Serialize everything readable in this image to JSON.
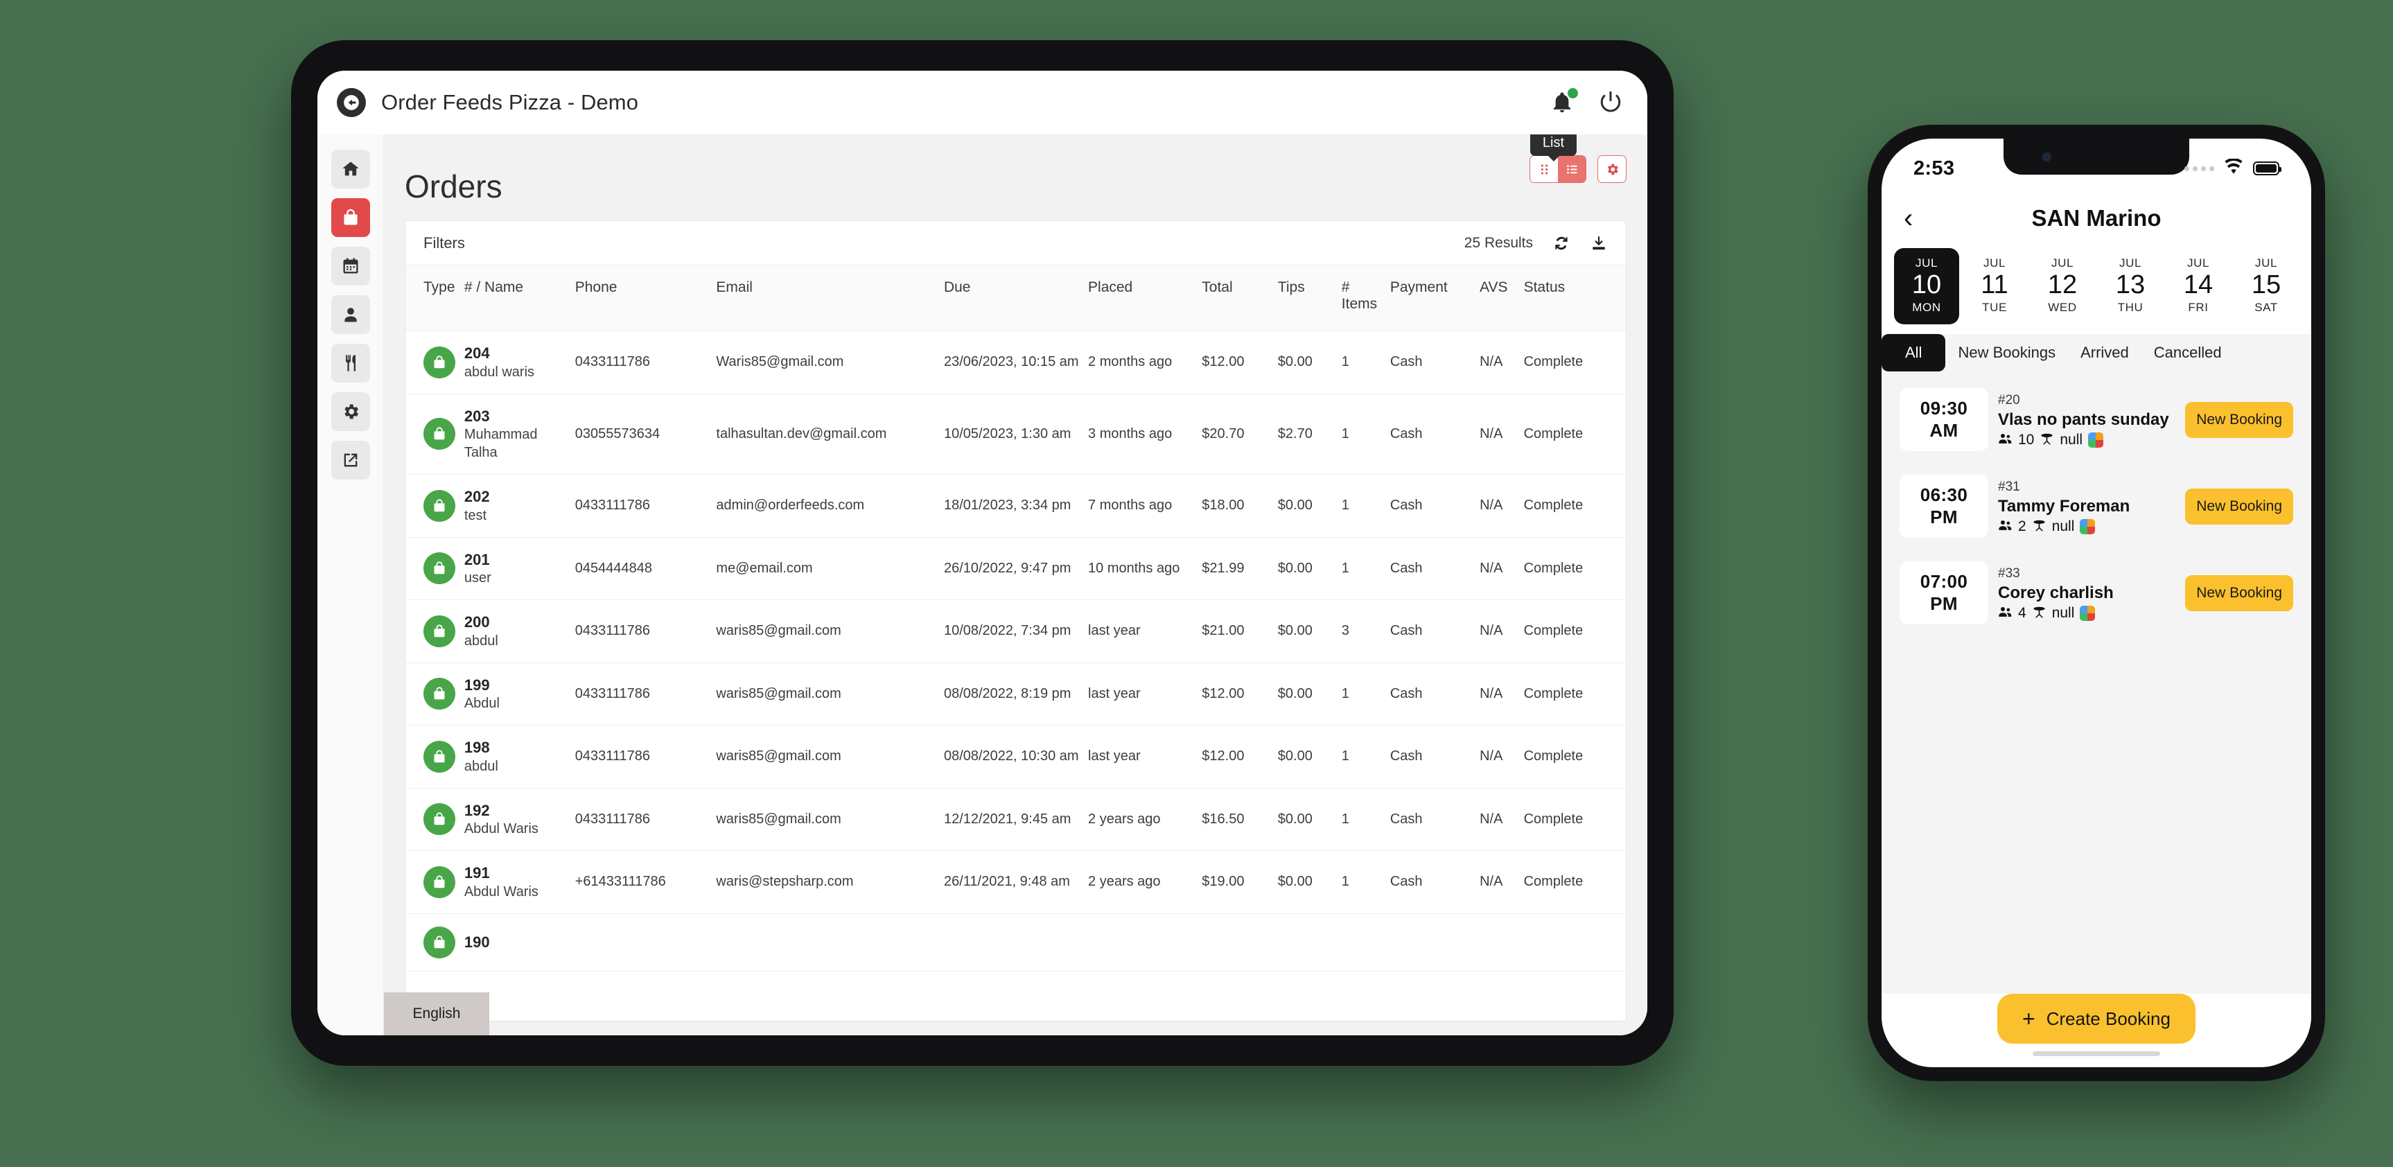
{
  "background_color": "#477150",
  "tablet": {
    "topbar": {
      "back_icon": "back-arrow-circle-icon",
      "title": "Order Feeds Pizza - Demo",
      "bell_icon": "notification-bell-icon",
      "bell_badge_color": "#2ea44f",
      "power_icon": "power-icon"
    },
    "sidebar": {
      "items": [
        {
          "icon": "home-icon",
          "name": "home",
          "active": false
        },
        {
          "icon": "shopping-bag-icon",
          "name": "orders",
          "active": true
        },
        {
          "icon": "calendar-icon",
          "name": "bookings",
          "active": false
        },
        {
          "icon": "person-icon",
          "name": "customers",
          "active": false
        },
        {
          "icon": "cutlery-icon",
          "name": "menu",
          "active": false
        },
        {
          "icon": "gear-icon",
          "name": "settings",
          "active": false
        },
        {
          "icon": "external-link-icon",
          "name": "open-external",
          "active": false
        }
      ],
      "active_color": "#e04a4a"
    },
    "page_title": "Orders",
    "view_toggle": {
      "tooltip": "List",
      "grid_icon": "grid-view-icon",
      "list_icon": "list-view-icon",
      "settings_icon": "gear-icon",
      "accent_color": "#e04a4a"
    },
    "panel": {
      "filters_label": "Filters",
      "results_count": "25 Results",
      "refresh_icon": "refresh-icon",
      "download_icon": "download-icon"
    },
    "table": {
      "columns": [
        "Type",
        "# / Name",
        "Phone",
        "Email",
        "Due",
        "Placed",
        "Total",
        "Tips",
        "# Items",
        "Payment",
        "AVS",
        "Status"
      ],
      "rows": [
        {
          "type_icon": "bag-icon",
          "number": "204",
          "name": "abdul waris",
          "phone": "0433111786",
          "email": "Waris85@gmail.com",
          "due": "23/06/2023, 10:15 am",
          "placed": "2 months ago",
          "total": "$12.00",
          "tips": "$0.00",
          "items": "1",
          "payment": "Cash",
          "avs": "N/A",
          "status": "Complete"
        },
        {
          "type_icon": "bag-icon",
          "number": "203",
          "name": "Muhammad Talha",
          "phone": "03055573634",
          "email": "talhasultan.dev@gmail.com",
          "due": "10/05/2023, 1:30 am",
          "placed": "3 months ago",
          "total": "$20.70",
          "tips": "$2.70",
          "items": "1",
          "payment": "Cash",
          "avs": "N/A",
          "status": "Complete"
        },
        {
          "type_icon": "bag-icon",
          "number": "202",
          "name": "test",
          "phone": "0433111786",
          "email": "admin@orderfeeds.com",
          "due": "18/01/2023, 3:34 pm",
          "placed": "7 months ago",
          "total": "$18.00",
          "tips": "$0.00",
          "items": "1",
          "payment": "Cash",
          "avs": "N/A",
          "status": "Complete"
        },
        {
          "type_icon": "bag-icon",
          "number": "201",
          "name": "user",
          "phone": "0454444848",
          "email": "me@email.com",
          "due": "26/10/2022, 9:47 pm",
          "placed": "10 months ago",
          "total": "$21.99",
          "tips": "$0.00",
          "items": "1",
          "payment": "Cash",
          "avs": "N/A",
          "status": "Complete"
        },
        {
          "type_icon": "bag-icon",
          "number": "200",
          "name": "abdul",
          "phone": "0433111786",
          "email": "waris85@gmail.com",
          "due": "10/08/2022, 7:34 pm",
          "placed": "last year",
          "total": "$21.00",
          "tips": "$0.00",
          "items": "3",
          "payment": "Cash",
          "avs": "N/A",
          "status": "Complete"
        },
        {
          "type_icon": "bag-icon",
          "number": "199",
          "name": "Abdul",
          "phone": "0433111786",
          "email": "waris85@gmail.com",
          "due": "08/08/2022, 8:19 pm",
          "placed": "last year",
          "total": "$12.00",
          "tips": "$0.00",
          "items": "1",
          "payment": "Cash",
          "avs": "N/A",
          "status": "Complete"
        },
        {
          "type_icon": "bag-icon",
          "number": "198",
          "name": "abdul",
          "phone": "0433111786",
          "email": "waris85@gmail.com",
          "due": "08/08/2022, 10:30 am",
          "placed": "last year",
          "total": "$12.00",
          "tips": "$0.00",
          "items": "1",
          "payment": "Cash",
          "avs": "N/A",
          "status": "Complete"
        },
        {
          "type_icon": "bag-icon",
          "number": "192",
          "name": "Abdul Waris",
          "phone": "0433111786",
          "email": "waris85@gmail.com",
          "due": "12/12/2021, 9:45 am",
          "placed": "2 years ago",
          "total": "$16.50",
          "tips": "$0.00",
          "items": "1",
          "payment": "Cash",
          "avs": "N/A",
          "status": "Complete"
        },
        {
          "type_icon": "bag-icon",
          "number": "191",
          "name": "Abdul Waris",
          "phone": "+61433111786",
          "email": "waris@stepsharp.com",
          "due": "26/11/2021, 9:48 am",
          "placed": "2 years ago",
          "total": "$19.00",
          "tips": "$0.00",
          "items": "1",
          "payment": "Cash",
          "avs": "N/A",
          "status": "Complete"
        },
        {
          "type_icon": "bag-icon",
          "number": "190",
          "name": "",
          "phone": "",
          "email": "",
          "due": "",
          "placed": "",
          "total": "",
          "tips": "",
          "items": "",
          "payment": "",
          "avs": "",
          "status": ""
        }
      ]
    },
    "language_tooltip": "English"
  },
  "phone": {
    "statusbar": {
      "time": "2:53",
      "wifi_icon": "wifi-icon",
      "battery_icon": "battery-icon"
    },
    "header": {
      "back_icon": "chevron-left-icon",
      "title": "SAN Marino"
    },
    "days": [
      {
        "month": "JUL",
        "day": "10",
        "dow": "MON",
        "active": true
      },
      {
        "month": "JUL",
        "day": "11",
        "dow": "TUE",
        "active": false
      },
      {
        "month": "JUL",
        "day": "12",
        "dow": "WED",
        "active": false
      },
      {
        "month": "JUL",
        "day": "13",
        "dow": "THU",
        "active": false
      },
      {
        "month": "JUL",
        "day": "14",
        "dow": "FRI",
        "active": false
      },
      {
        "month": "JUL",
        "day": "15",
        "dow": "SAT",
        "active": false
      }
    ],
    "tabs": [
      {
        "label": "All",
        "active": true
      },
      {
        "label": "New Bookings",
        "active": false
      },
      {
        "label": "Arrived",
        "active": false
      },
      {
        "label": "Cancelled",
        "active": false
      }
    ],
    "bookings": [
      {
        "time": "09:30",
        "ampm": "AM",
        "number": "#20",
        "name": "Vlas no pants sunday",
        "guests_icon": "people-icon",
        "guests": "10",
        "table_icon": "table-icon",
        "table": "null",
        "app_icon": "app-grid-icon",
        "status_label": "New Booking"
      },
      {
        "time": "06:30",
        "ampm": "PM",
        "number": "#31",
        "name": "Tammy Foreman",
        "guests_icon": "people-icon",
        "guests": "2",
        "table_icon": "table-icon",
        "table": "null",
        "app_icon": "app-grid-icon",
        "status_label": "New Booking"
      },
      {
        "time": "07:00",
        "ampm": "PM",
        "number": "#33",
        "name": "Corey charlish",
        "guests_icon": "people-icon",
        "guests": "4",
        "table_icon": "table-icon",
        "table": "null",
        "app_icon": "app-grid-icon",
        "status_label": "New Booking"
      }
    ],
    "create_button": {
      "plus_icon": "plus-icon",
      "label": "Create Booking",
      "color": "#FBC02D"
    }
  }
}
